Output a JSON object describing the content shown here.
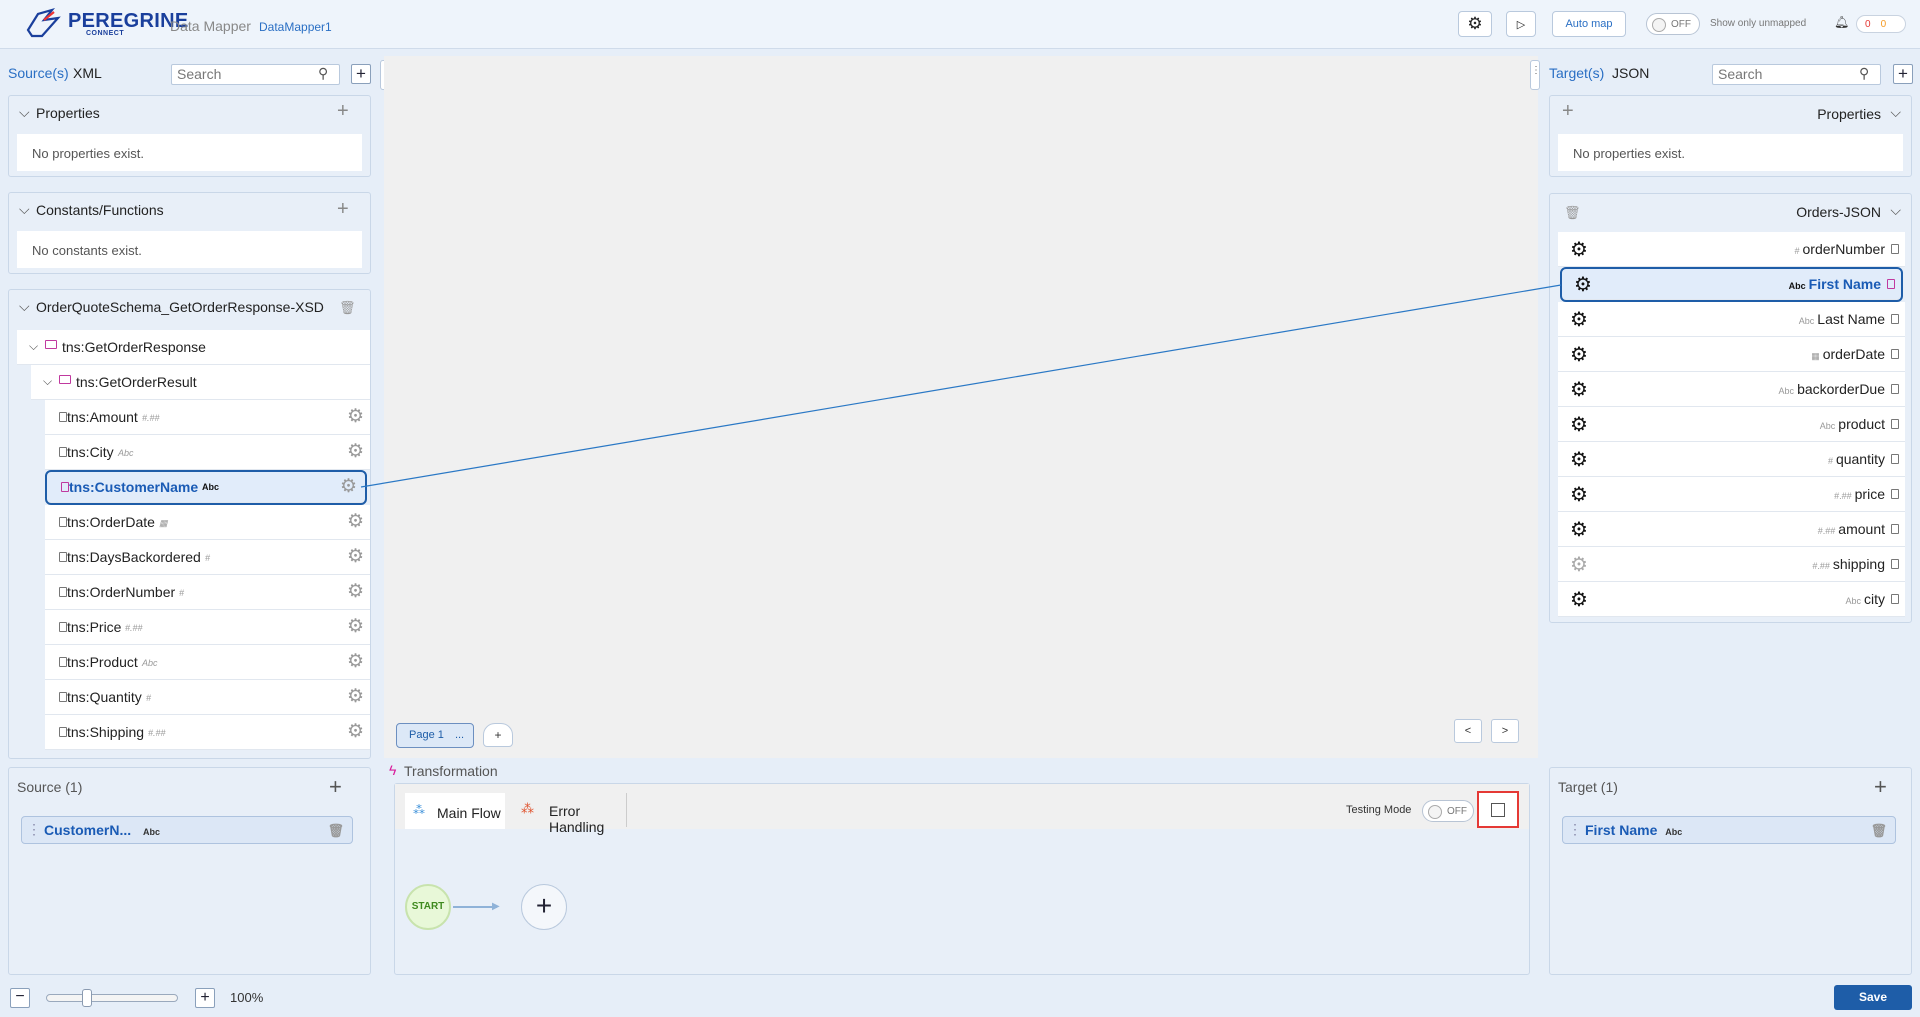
{
  "header": {
    "brand": "PEREGRINE",
    "brand_sub": "CONNECT",
    "app_title": "Data Mapper",
    "file_name": "DataMapper1",
    "auto_map": "Auto map",
    "toggle_off": "OFF",
    "show_unmapped": "Show only unmapped",
    "notif_red": "0",
    "notif_orange": "0"
  },
  "source": {
    "label": "Source(s)",
    "format": "XML",
    "search_placeholder": "Search",
    "properties_title": "Properties",
    "properties_empty": "No properties exist.",
    "constants_title": "Constants/Functions",
    "constants_empty": "No constants exist.",
    "schema_title": "OrderQuoteSchema_GetOrderResponse-XSD",
    "root": "tns:GetOrderResponse",
    "result": "tns:GetOrderResult",
    "fields": [
      {
        "name": "tns:Amount",
        "type": "#.##"
      },
      {
        "name": "tns:City",
        "type": "Abc"
      },
      {
        "name": "tns:CustomerName",
        "type": "Abc"
      },
      {
        "name": "tns:OrderDate",
        "type": "▦"
      },
      {
        "name": "tns:DaysBackordered",
        "type": "#"
      },
      {
        "name": "tns:OrderNumber",
        "type": "#"
      },
      {
        "name": "tns:Price",
        "type": "#.##"
      },
      {
        "name": "tns:Product",
        "type": "Abc"
      },
      {
        "name": "tns:Quantity",
        "type": "#"
      },
      {
        "name": "tns:Shipping",
        "type": "#.##"
      }
    ]
  },
  "target": {
    "label": "Target(s)",
    "format": "JSON",
    "search_placeholder": "Search",
    "properties_title": "Properties",
    "properties_empty": "No properties exist.",
    "schema_title": "Orders-JSON",
    "fields": [
      {
        "name": "orderNumber",
        "type": "#"
      },
      {
        "name": "First Name",
        "type": "Abc"
      },
      {
        "name": "Last Name",
        "type": "Abc"
      },
      {
        "name": "orderDate",
        "type": "▦"
      },
      {
        "name": "backorderDue",
        "type": "Abc"
      },
      {
        "name": "product",
        "type": "Abc"
      },
      {
        "name": "quantity",
        "type": "#"
      },
      {
        "name": "price",
        "type": "#.##"
      },
      {
        "name": "amount",
        "type": "#.##"
      },
      {
        "name": "shipping",
        "type": "#.##"
      },
      {
        "name": "city",
        "type": "Abc"
      }
    ]
  },
  "canvas": {
    "page_tab": "Page 1",
    "page_tab_more": "...",
    "add_page": "+",
    "prev": "<",
    "next": ">"
  },
  "bottom": {
    "source_title": "Source (1)",
    "source_chip": "CustomerN...",
    "source_chip_type": "Abc",
    "transformation_title": "Transformation",
    "tab_main": "Main Flow",
    "tab_error": "Error Handling",
    "testing_mode": "Testing Mode",
    "testing_off": "OFF",
    "start": "START",
    "target_title": "Target (1)",
    "target_chip": "First Name",
    "target_chip_type": "Abc"
  },
  "footer": {
    "zoom": "100%",
    "zoom_level": 0.3,
    "save": "Save"
  },
  "colors": {
    "accent": "#1e5da8",
    "highlight_box": "#e53935",
    "mapping_line": "#2a78c5"
  }
}
